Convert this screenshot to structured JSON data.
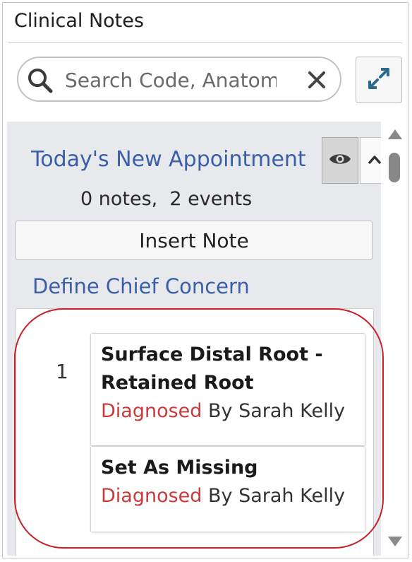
{
  "header": {
    "title": "Clinical Notes"
  },
  "search": {
    "placeholder": "Search Code, Anatomy",
    "value": ""
  },
  "appointment": {
    "title": "Today's New Appointment",
    "counts": "0 notes,  2 events",
    "insert_label": "Insert Note",
    "chief_concern_label": "Define Chief Concern"
  },
  "notes": [
    {
      "number": "1",
      "entries": [
        {
          "title": "Surface Distal Root - Retained Root",
          "status": "Diagnosed",
          "by": " By Sarah Kelly"
        },
        {
          "title": "Set As Missing",
          "status": "Diagnosed",
          "by": " By Sarah Kelly"
        }
      ]
    }
  ],
  "colors": {
    "link": "#3a5ea8",
    "status_diagnosed": "#c93a3a",
    "highlight": "#c8202a"
  },
  "icons": {
    "search": "search-icon",
    "clear": "close-icon",
    "expand": "expand-icon",
    "visibility": "eye-icon",
    "collapse": "chevron-up-icon"
  }
}
